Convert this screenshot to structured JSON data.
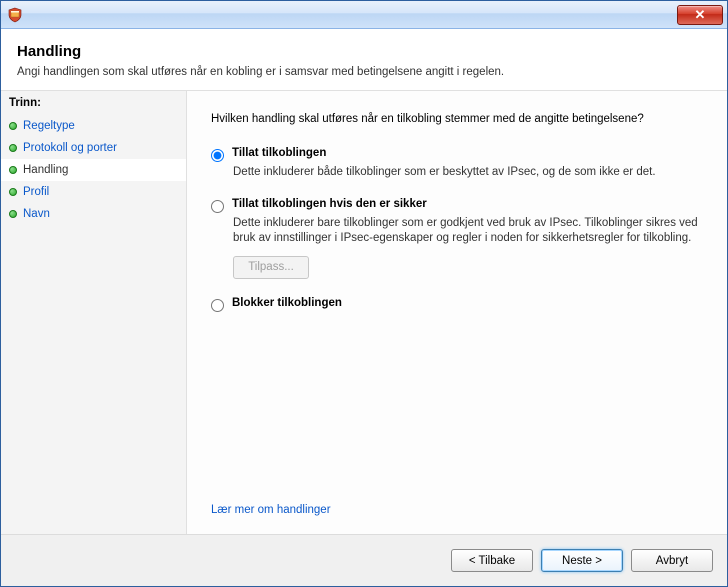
{
  "window": {
    "close_glyph": "✕"
  },
  "header": {
    "title": "Handling",
    "subtitle": "Angi handlingen som skal utføres når en kobling er i samsvar med betingelsene angitt i regelen."
  },
  "sidebar": {
    "title": "Trinn:",
    "items": [
      {
        "label": "Regeltype",
        "current": false
      },
      {
        "label": "Protokoll og porter",
        "current": false
      },
      {
        "label": "Handling",
        "current": true
      },
      {
        "label": "Profil",
        "current": false
      },
      {
        "label": "Navn",
        "current": false
      }
    ]
  },
  "main": {
    "question": "Hvilken handling skal utføres når en tilkobling stemmer med de angitte betingelsene?",
    "options": {
      "allow": {
        "label": "Tillat tilkoblingen",
        "desc": "Dette inkluderer både tilkoblinger som er beskyttet av IPsec, og de som ikke er det."
      },
      "allow_secure": {
        "label": "Tillat tilkoblingen hvis den er sikker",
        "desc": "Dette inkluderer bare tilkoblinger som er godkjent ved bruk av IPsec. Tilkoblinger sikres ved bruk av innstillinger i IPsec-egenskaper og regler i noden for sikkerhetsregler for tilkobling.",
        "customize_label": "Tilpass..."
      },
      "block": {
        "label": "Blokker tilkoblingen"
      }
    },
    "selected": "allow",
    "learn_more": "Lær mer om handlinger"
  },
  "footer": {
    "back": "< Tilbake",
    "next": "Neste >",
    "cancel": "Avbryt"
  }
}
